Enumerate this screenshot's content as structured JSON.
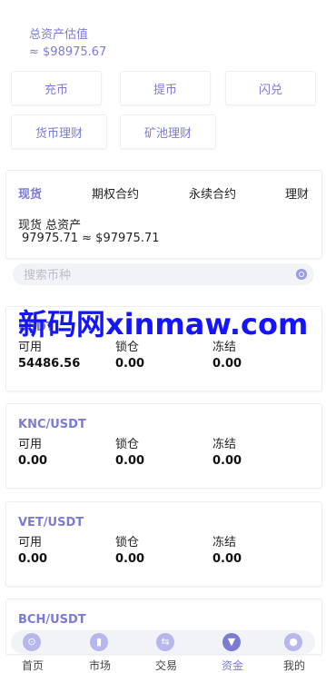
{
  "header": {
    "estimate_label": "总资产估值",
    "estimate_value": "≈ $98975.67"
  },
  "actions": [
    "充币",
    "提币",
    "闪兑",
    "货币理财",
    "矿池理财"
  ],
  "tabs": [
    "现货",
    "期权合约",
    "永续合约",
    "理财"
  ],
  "spot": {
    "label": "现货 总资产",
    "value": "97975.71 ≈ $97975.71"
  },
  "search": {
    "placeholder": "搜索币种"
  },
  "watermark": "新码网xinmaw.com",
  "column_labels": {
    "available": "可用",
    "locked": "锁仓",
    "frozen": "冻结"
  },
  "assets": [
    {
      "pair": "USDT",
      "available": "54486.56",
      "locked": "0.00",
      "frozen": "0.00"
    },
    {
      "pair": "KNC/USDT",
      "available": "0.00",
      "locked": "0.00",
      "frozen": "0.00"
    },
    {
      "pair": "VET/USDT",
      "available": "0.00",
      "locked": "0.00",
      "frozen": "0.00"
    },
    {
      "pair": "BCH/USDT",
      "available": "",
      "locked": "",
      "frozen": ""
    }
  ],
  "nav": [
    {
      "label": "首页",
      "icon": "compass-icon"
    },
    {
      "label": "市场",
      "icon": "bar-chart-icon"
    },
    {
      "label": "交易",
      "icon": "trade-icon"
    },
    {
      "label": "资金",
      "icon": "shield-icon",
      "active": true
    },
    {
      "label": "我的",
      "icon": "user-icon"
    }
  ],
  "colors": {
    "accent": "#7b7bd6",
    "watermark": "#1414ff"
  }
}
